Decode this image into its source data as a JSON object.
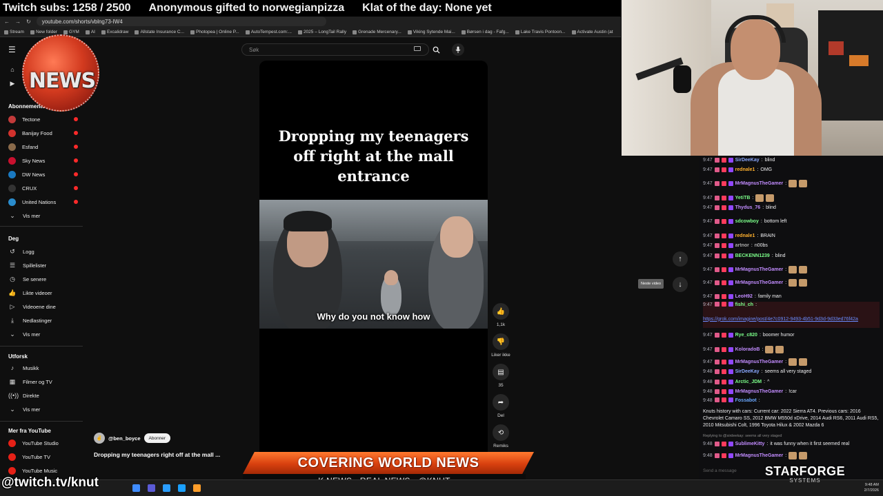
{
  "overlay": {
    "subs": "Twitch subs: 1258 / 2500",
    "gifted": "Anonymous gifted to norwegianpizza",
    "klat": "Klat of the day: None yet",
    "twitch_handle": "@twitch.tv/knut",
    "banner": "COVERING WORLD NEWS",
    "sub_banner": "K NEWS - REAL NEWS - @KNUT",
    "logo_text": "NEWS",
    "sponsor_title": "STARFORGE",
    "sponsor_sub": "SYSTEMS"
  },
  "browser": {
    "url": "youtube.com/shorts/vblng73-IW4",
    "bookmarks": [
      "Stream",
      "New folder",
      "GYM",
      "AI",
      "Excalidraw",
      "Allstate Insurance C...",
      "Photopea | Online P...",
      "AutoTempest.com:...",
      "2025 – LongTail Rally",
      "Grenade Mercenary...",
      "Viking Sytende Mai...",
      "Børsen i dag - Fafg...",
      "Lake Travis Pontoon...",
      "Activate Austin (at"
    ]
  },
  "youtube": {
    "search_placeholder": "Søk",
    "sidebar": {
      "subscriptions_heading": "Abonnementer",
      "channels": [
        {
          "name": "Tectone",
          "color": "#c23a3a"
        },
        {
          "name": "Banijay Food",
          "color": "#d2322d"
        },
        {
          "name": "Esfand",
          "color": "#8a6a4a"
        },
        {
          "name": "Sky News",
          "color": "#c8102e"
        },
        {
          "name": "DW News",
          "color": "#1a79c0"
        },
        {
          "name": "CRUX",
          "color": "#333333"
        },
        {
          "name": "United Nations",
          "color": "#2a8ccc"
        }
      ],
      "show_more_1": "Vis mer",
      "you_heading": "Deg",
      "you_items": [
        "Logg",
        "Spillelister",
        "Se senere",
        "Likte videoer",
        "Videoene dine",
        "Nedlastinger"
      ],
      "show_more_2": "Vis mer",
      "explore_heading": "Utforsk",
      "explore_items": [
        "Musikk",
        "Filmer og TV",
        "Direkte"
      ],
      "show_more_3": "Vis mer",
      "more_heading": "Mer fra YouTube",
      "more_items": [
        "YouTube Studio",
        "YouTube TV",
        "YouTube Music"
      ]
    },
    "short": {
      "caption": "Dropping my teenagers off right at the mall entrance",
      "subtitle": "Why do you not know how",
      "channel": "@ben_boyce",
      "subscribe_label": "Abonner",
      "title": "Dropping my teenagers right off at the mall ...",
      "likes": "1,1k",
      "dislike_label": "Liker ikke",
      "comments": "35",
      "share_label": "Del",
      "remix_label": "Remiks"
    },
    "next_tooltip": "Neste video"
  },
  "chat": {
    "input_placeholder": "Send a message",
    "messages": [
      {
        "time": "9:47",
        "user": "SirDeeKay",
        "color": "#8aa8ff",
        "text": "blind"
      },
      {
        "time": "9:47",
        "user": "rednale1",
        "color": "#ffb02e",
        "text": "OMG"
      },
      {
        "time": "9:47",
        "user": "MrMagnusTheGamer",
        "color": "#c28cff",
        "text": ""
      },
      {
        "time": "9:47",
        "user": "YetiTB",
        "color": "#7cff8a",
        "text": ""
      },
      {
        "time": "9:47",
        "user": "Thydus_76",
        "color": "#c28cff",
        "text": "blind"
      },
      {
        "time": "9:47",
        "user": "sdcowboy",
        "color": "#7cff8a",
        "text": "bottom left"
      },
      {
        "time": "9:47",
        "user": "rednale1",
        "color": "#ffb02e",
        "text": "BRAIN"
      },
      {
        "time": "9:47",
        "user": "artnor",
        "color": "#aaaaaa",
        "text": "n00bs"
      },
      {
        "time": "9:47",
        "user": "BECKENN1239",
        "color": "#7cff8a",
        "text": "blind"
      },
      {
        "time": "9:47",
        "user": "MrMagnusTheGamer",
        "color": "#c28cff",
        "text": ""
      },
      {
        "time": "9:47",
        "user": "MrMagnusTheGamer",
        "color": "#c28cff",
        "text": ""
      },
      {
        "time": "9:47",
        "user": "LeoH92",
        "color": "#c28cff",
        "text": "family man"
      },
      {
        "time": "9:47",
        "user": "fishi_ch",
        "color": "#7cff8a",
        "text": "https://grok.com/imagine/post/4e7c0912-9493-4b51-9d3d-9d33ed76f42a"
      },
      {
        "time": "9:47",
        "user": "Rye_c820",
        "color": "#7cff8a",
        "text": "boomer humor"
      },
      {
        "time": "9:47",
        "user": "KoloradoB",
        "color": "#c28cff",
        "text": ""
      },
      {
        "time": "9:47",
        "user": "MrMagnusTheGamer",
        "color": "#c28cff",
        "text": ""
      },
      {
        "time": "9:48",
        "user": "SirDeeKay",
        "color": "#8aa8ff",
        "text": "seems all very staged"
      },
      {
        "time": "9:48",
        "user": "Arctic_JDM",
        "color": "#7cff8a",
        "text": "^"
      },
      {
        "time": "9:48",
        "user": "MrMagnusTheGamer",
        "color": "#c28cff",
        "text": "!car"
      },
      {
        "time": "9:48",
        "user": "Fossabot",
        "color": "#6aa8ff",
        "text": "Knuts history with cars: Current car: 2022 Sierra AT4. Previous cars: 2016 Chevrolet Camaro SS, 2012 BMW M550d xDrive, 2014 Audi RS6, 2011 Audi RS5, 2010 Mitsubishi Colt, 1996 Toyota Hilux & 2002 Mazda 6"
      },
      {
        "time": "9:48",
        "user": "SublimeKitty",
        "color": "#c28cff",
        "text": "it was funny when it first seemed real",
        "reply": "Replying to @sirdeekay: seems all very staged"
      },
      {
        "time": "9:48",
        "user": "MrMagnusTheGamer",
        "color": "#c28cff",
        "text": ""
      }
    ]
  },
  "taskbar": {
    "time": "9:48 AM",
    "date": "2/7/2026"
  }
}
